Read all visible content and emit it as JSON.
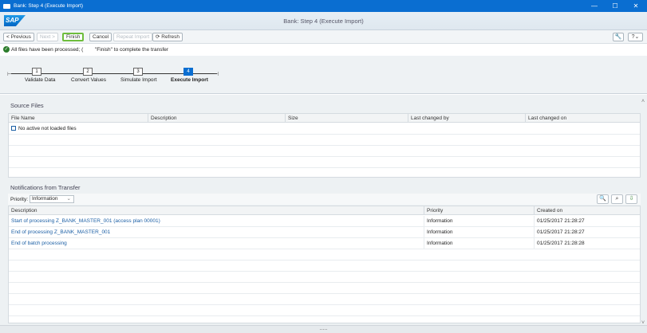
{
  "window": {
    "title": "Bank: Step 4  (Execute Import)",
    "controls": {
      "minimize": "—",
      "maximize": "☐",
      "close": "✕"
    }
  },
  "sap": {
    "logo": "SAP",
    "title": "Bank: Step 4  (Execute Import)"
  },
  "toolbar": {
    "previous": "< Previous",
    "next": "Next >",
    "finish": "Finish",
    "cancel": "Cancel",
    "repeat_import": "Repeat Import",
    "refresh": "⟳  Refresh",
    "settings_icon": "🔧",
    "help_icon": "?⌄"
  },
  "message": {
    "part1": "All files have been processed; (",
    "part2": "\"Finish\" to complete the transfer"
  },
  "steps": [
    {
      "number": "1",
      "label": "Validate Data"
    },
    {
      "number": "2",
      "label": "Convert Values"
    },
    {
      "number": "3",
      "label": "Simulate Import"
    },
    {
      "number": "4",
      "label": "Execute Import"
    }
  ],
  "source_files": {
    "title": "Source Files",
    "columns": [
      "File Name",
      "Description",
      "Size",
      "Last changed by",
      "Last changed on"
    ],
    "empty_text": "No active not loaded files"
  },
  "notifications": {
    "title": "Notifications from Transfer",
    "priority_label": "Priority:",
    "priority_value": "Information",
    "columns": [
      "Description",
      "Priority",
      "Created on"
    ],
    "rows": [
      {
        "description": "Start of processing Z_BANK_MASTER_001 (access plan 00001)",
        "priority": "Information",
        "created": "01/25/2017 21:28:27"
      },
      {
        "description": "End of processing Z_BANK_MASTER_001",
        "priority": "Information",
        "created": "01/25/2017 21:28:27"
      },
      {
        "description": "End of batch processing",
        "priority": "Information",
        "created": "01/25/2017 21:28:28"
      }
    ]
  },
  "bottom": {
    "handle": "....."
  }
}
